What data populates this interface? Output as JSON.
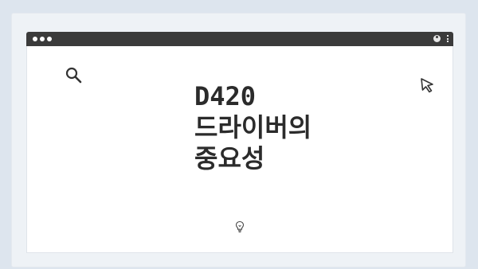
{
  "heading": {
    "line1": "D420",
    "line2": "드라이버의",
    "line3": "중요성"
  },
  "icons": {
    "top_dots": "carousel-dots-icon",
    "window_controls": "window-dots-icon",
    "user": "user-icon",
    "menu": "kebab-menu-icon",
    "search": "search-icon",
    "cursor": "cursor-arrow-icon",
    "bulb": "lightbulb-icon"
  },
  "colors": {
    "background": "#dde5ee",
    "titlebar": "#3b3b3b",
    "content": "#ffffff",
    "text": "#2b2b2b"
  }
}
